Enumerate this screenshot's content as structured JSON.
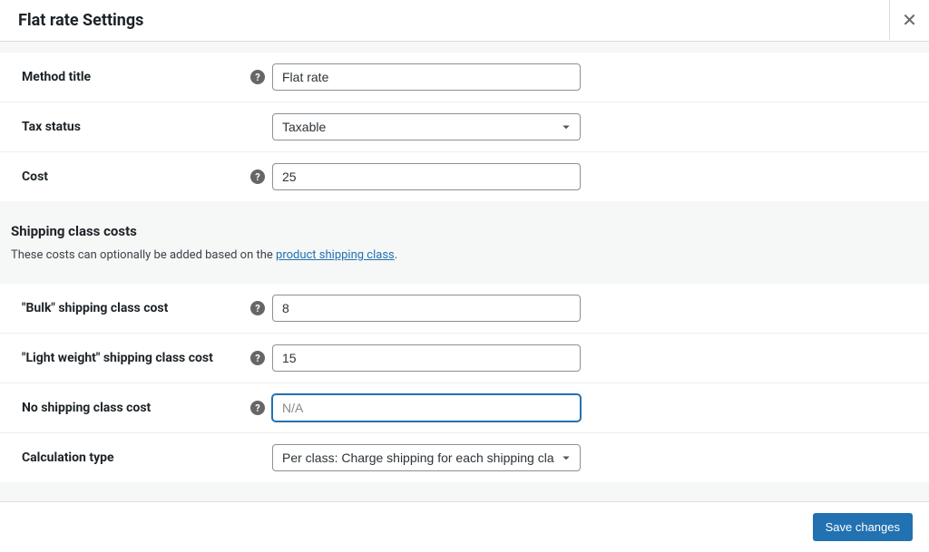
{
  "header": {
    "title": "Flat rate Settings"
  },
  "form": {
    "method_title": {
      "label": "Method title",
      "value": "Flat rate",
      "has_help": true
    },
    "tax_status": {
      "label": "Tax status",
      "selected": "Taxable",
      "has_help": false
    },
    "cost": {
      "label": "Cost",
      "value": "25",
      "has_help": true
    }
  },
  "shipping_section": {
    "title": "Shipping class costs",
    "description_prefix": "These costs can optionally be added based on the ",
    "description_link": "product shipping class",
    "description_suffix": "."
  },
  "shipping_classes": {
    "bulk": {
      "label": "\"Bulk\" shipping class cost",
      "value": "8",
      "has_help": true
    },
    "light_weight": {
      "label": "\"Light weight\" shipping class cost",
      "value": "15",
      "has_help": true
    },
    "no_class": {
      "label": "No shipping class cost",
      "value": "",
      "placeholder": "N/A",
      "has_help": true
    },
    "calc_type": {
      "label": "Calculation type",
      "selected": "Per class: Charge shipping for each shipping class individually",
      "has_help": false
    }
  },
  "footer": {
    "save_label": "Save changes"
  }
}
